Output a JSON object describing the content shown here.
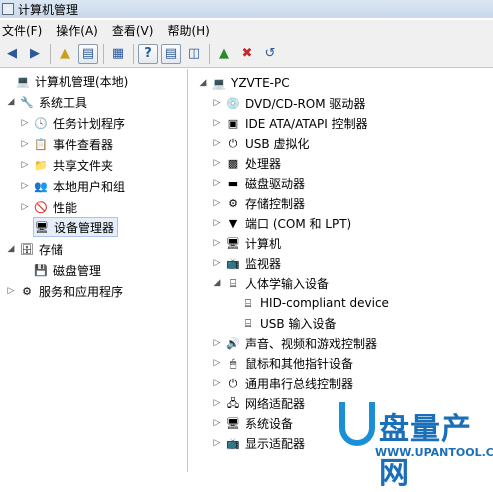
{
  "window": {
    "title": "计算机管理"
  },
  "menu": [
    "文件(F)",
    "操作(A)",
    "查看(V)",
    "帮助(H)"
  ],
  "left_tree": [
    {
      "label": "计算机管理(本地)",
      "icon": "computer-management-icon",
      "level": 0,
      "expander": "none"
    },
    {
      "label": "系统工具",
      "icon": "tools-icon",
      "level": 1,
      "expander": "expanded"
    },
    {
      "label": "任务计划程序",
      "icon": "clock-icon",
      "level": 2,
      "expander": "collapsed"
    },
    {
      "label": "事件查看器",
      "icon": "event-viewer-icon",
      "level": 2,
      "expander": "collapsed"
    },
    {
      "label": "共享文件夹",
      "icon": "shared-folder-icon",
      "level": 2,
      "expander": "collapsed"
    },
    {
      "label": "本地用户和组",
      "icon": "users-icon",
      "level": 2,
      "expander": "collapsed"
    },
    {
      "label": "性能",
      "icon": "performance-icon",
      "level": 2,
      "expander": "collapsed"
    },
    {
      "label": "设备管理器",
      "icon": "device-manager-icon",
      "level": 2,
      "expander": "none",
      "selected": true
    },
    {
      "label": "存储",
      "icon": "storage-icon",
      "level": 1,
      "expander": "expanded"
    },
    {
      "label": "磁盘管理",
      "icon": "disk-management-icon",
      "level": 2,
      "expander": "none"
    },
    {
      "label": "服务和应用程序",
      "icon": "services-icon",
      "level": 1,
      "expander": "collapsed"
    }
  ],
  "device_tree": [
    {
      "label": "YZVTE-PC",
      "icon": "computer-icon",
      "level": 0,
      "expander": "expanded"
    },
    {
      "label": "DVD/CD-ROM 驱动器",
      "icon": "dvd-drive-icon",
      "level": 1,
      "expander": "collapsed"
    },
    {
      "label": "IDE ATA/ATAPI 控制器",
      "icon": "ide-controller-icon",
      "level": 1,
      "expander": "collapsed"
    },
    {
      "label": "USB 虚拟化",
      "icon": "usb-icon",
      "level": 1,
      "expander": "collapsed"
    },
    {
      "label": "处理器",
      "icon": "processor-icon",
      "level": 1,
      "expander": "collapsed"
    },
    {
      "label": "磁盘驱动器",
      "icon": "disk-drive-icon",
      "level": 1,
      "expander": "collapsed"
    },
    {
      "label": "存储控制器",
      "icon": "storage-controller-icon",
      "level": 1,
      "expander": "collapsed"
    },
    {
      "label": "端口 (COM 和 LPT)",
      "icon": "port-icon",
      "level": 1,
      "expander": "collapsed"
    },
    {
      "label": "计算机",
      "icon": "computer-icon",
      "level": 1,
      "expander": "collapsed"
    },
    {
      "label": "监视器",
      "icon": "monitor-icon",
      "level": 1,
      "expander": "collapsed"
    },
    {
      "label": "人体学输入设备",
      "icon": "hid-icon",
      "level": 1,
      "expander": "expanded"
    },
    {
      "label": "HID-compliant device",
      "icon": "hid-device-icon",
      "level": 2,
      "expander": "none"
    },
    {
      "label": "USB 输入设备",
      "icon": "hid-device-icon",
      "level": 2,
      "expander": "none"
    },
    {
      "label": "声音、视频和游戏控制器",
      "icon": "sound-icon",
      "level": 1,
      "expander": "collapsed"
    },
    {
      "label": "鼠标和其他指针设备",
      "icon": "mouse-icon",
      "level": 1,
      "expander": "collapsed"
    },
    {
      "label": "通用串行总线控制器",
      "icon": "usb-controller-icon",
      "level": 1,
      "expander": "collapsed"
    },
    {
      "label": "网络适配器",
      "icon": "network-adapter-icon",
      "level": 1,
      "expander": "collapsed"
    },
    {
      "label": "系统设备",
      "icon": "system-device-icon",
      "level": 1,
      "expander": "collapsed"
    },
    {
      "label": "显示适配器",
      "icon": "display-adapter-icon",
      "level": 1,
      "expander": "collapsed"
    }
  ],
  "watermark": {
    "brand": "盘量产网",
    "url": "WWW.UPANTOOL.COM"
  }
}
